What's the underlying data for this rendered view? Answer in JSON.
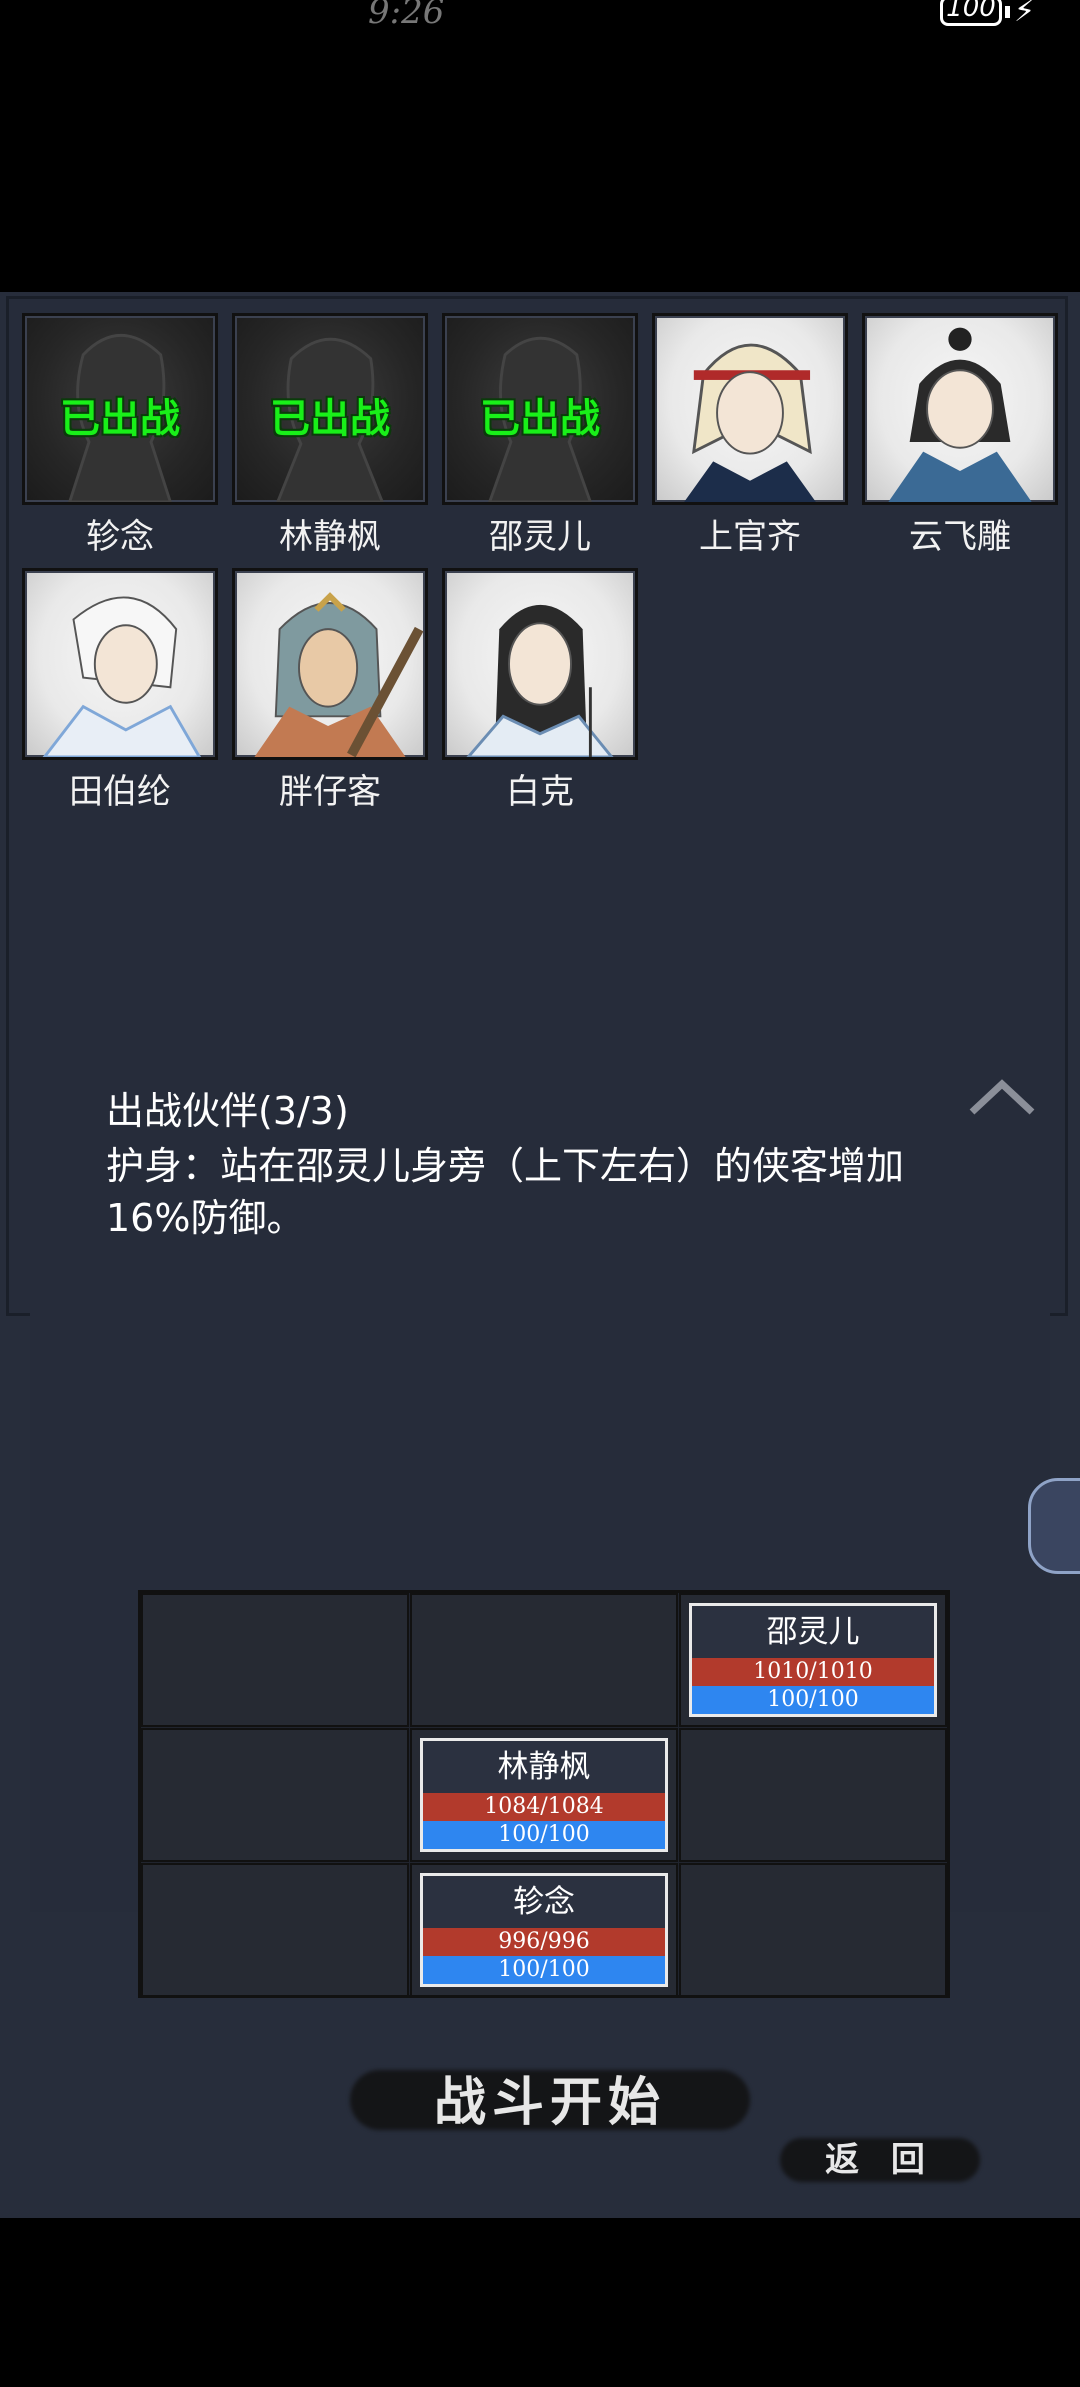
{
  "status_bar": {
    "time": "9:26",
    "battery": "100"
  },
  "deployed_label": "已出战",
  "roster": [
    {
      "name": "轸念",
      "deployed": true
    },
    {
      "name": "林静枫",
      "deployed": true
    },
    {
      "name": "邵灵儿",
      "deployed": true
    },
    {
      "name": "上官齐",
      "deployed": false
    },
    {
      "name": "云飞雕",
      "deployed": false
    },
    {
      "name": "田伯纶",
      "deployed": false
    },
    {
      "name": "胖仔客",
      "deployed": false
    },
    {
      "name": "白克",
      "deployed": false
    }
  ],
  "party": {
    "title": "出战伙伴(3/3)",
    "description": "护身：站在邵灵儿身旁（上下左右）的侠客增加16%防御。"
  },
  "formation": [
    {
      "name": "邵灵儿",
      "hp": "1010/1010",
      "mp": "100/100"
    },
    {
      "name": "林静枫",
      "hp": "1084/1084",
      "mp": "100/100"
    },
    {
      "name": "轸念",
      "hp": "996/996",
      "mp": "100/100"
    }
  ],
  "buttons": {
    "start": "战斗开始",
    "back": "返 回"
  },
  "colors": {
    "background": "#272d3b",
    "deployed_text": "#19f019",
    "hp_bar": "#b23a2c",
    "mp_bar": "#2e86f0"
  }
}
